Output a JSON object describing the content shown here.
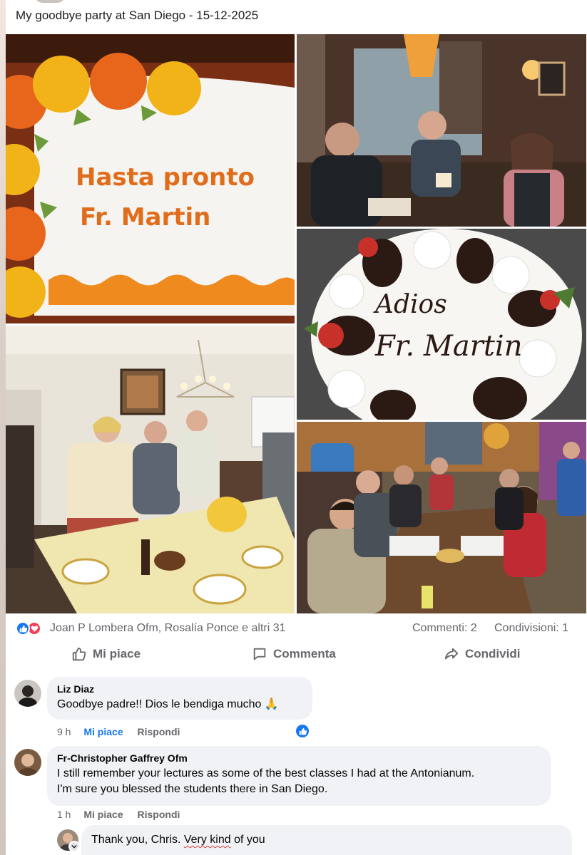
{
  "post": {
    "title": "My goodbye party at San Diego - 15-12-2025"
  },
  "photos": [
    {
      "name": "cake-hasta-pronto",
      "caption_lines": [
        "Hasta pronto",
        "Fr. Martin"
      ]
    },
    {
      "name": "restaurant-toast"
    },
    {
      "name": "cake-adios",
      "caption_lines": [
        "Adios",
        "Fr. Martin"
      ]
    },
    {
      "name": "dining-room-dinner"
    },
    {
      "name": "mexican-restaurant-group"
    }
  ],
  "reactions": {
    "icons": [
      "like-icon",
      "love-icon"
    ],
    "summary": "Joan P Lombera Ofm, Rosalía Ponce e altri 31",
    "comments": "Commenti: 2",
    "shares": "Condivisioni: 1"
  },
  "actions": {
    "like": "Mi piace",
    "comment": "Commenta",
    "share": "Condividi"
  },
  "comments": [
    {
      "author": "Liz Diaz",
      "text": "Goodbye padre!! Dios le bendiga mucho 🙏",
      "time": "9 h",
      "like_label": "Mi piace",
      "reply_label": "Rispondi",
      "liked": true
    },
    {
      "author": "Fr-Christopher Gaffrey Ofm",
      "text_line1": "I still remember your lectures as some of the best classes I had at the Antonianum.",
      "text_line2": "I'm sure you blessed the students there in San Diego.",
      "time": "1 h",
      "like_label": "Mi piace",
      "reply_label": "Rispondi"
    }
  ],
  "reply": {
    "text_before": "Thank you, Chris. ",
    "text_squiggle": "Very kind",
    "text_after": " of you"
  },
  "colors": {
    "accent": "#1877f2",
    "love": "#f33e58",
    "muted_text": "#65676b",
    "bubble": "#f0f2f5"
  }
}
